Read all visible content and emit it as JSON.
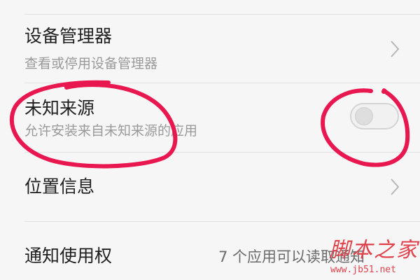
{
  "settings": {
    "rows": [
      {
        "title": "设备管理器",
        "subtitle": "查看或停用设备管理器",
        "control": "chevron-right-icon"
      },
      {
        "title": "未知来源",
        "subtitle": "允许安装来自未知来源的应用",
        "control": "toggle-switch",
        "toggle_on": false
      },
      {
        "title": "位置信息",
        "control": "chevron-right-icon"
      },
      {
        "title": "通知使用权",
        "value": "7 个应用可以读取通知"
      }
    ]
  },
  "annotations": {
    "highlight_color": "#e8174f",
    "circled": [
      "未知来源",
      "toggle-switch"
    ]
  },
  "watermark": {
    "name": "脚本之家",
    "url": "www.jb51.net",
    "color": "#e0424b"
  },
  "colors": {
    "background": "#f6f6f6",
    "title_text": "#1f1f1f",
    "subtitle_text": "#9a9a9a",
    "divider": "#e2e2e2"
  }
}
